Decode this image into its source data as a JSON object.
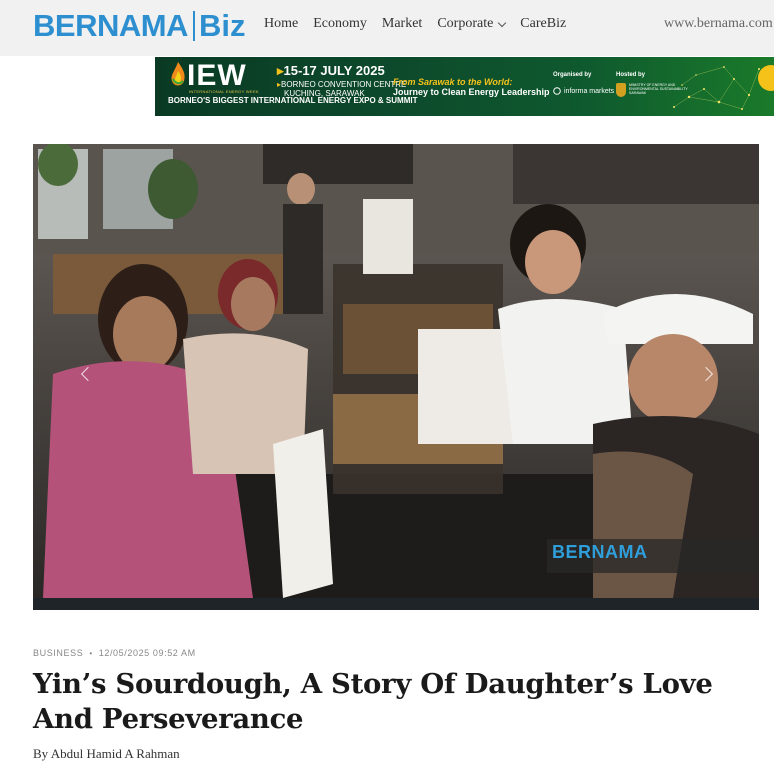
{
  "header": {
    "logo_main": "BERNAMA",
    "logo_sub": "Biz",
    "nav": [
      {
        "label": "Home"
      },
      {
        "label": "Economy"
      },
      {
        "label": "Market"
      },
      {
        "label": "Corporate",
        "has_dropdown": true
      },
      {
        "label": "CareBiz"
      }
    ],
    "site_link": "www.bernama.com"
  },
  "banner": {
    "event_abbr": "IEW",
    "event_full": "INTERNATIONAL ENERGY WEEK",
    "dates": "15-17 JULY 2025",
    "venue_line1": "BORNEO CONVENTION CENTRE",
    "venue_line2": "KUCHING, SARAWAK",
    "tagline": "BORNEO'S BIGGEST INTERNATIONAL ENERGY EXPO & SUMMIT",
    "slogan_line1": "From Sarawak to the World:",
    "slogan_line2": "Journey to Clean Energy Leadership",
    "organised_by_label": "Organised by",
    "organiser": "informa markets",
    "hosted_by_label": "Hosted by",
    "host": "MINISTRY OF ENERGY AND ENVIRONMENTAL SUSTAINABILITY SARAWAK"
  },
  "photo": {
    "watermark": "BERNAMA"
  },
  "article": {
    "category": "BUSINESS",
    "datetime": "12/05/2025 09:52 AM",
    "title": "Yin’s Sourdough, A Story Of Daughter’s Love And Perseverance",
    "byline": "By Abdul Hamid A Rahman"
  },
  "colors": {
    "brand_blue": "#2d8fcf",
    "header_bg": "#f1f1f1",
    "banner_green": "#0d4a2c",
    "banner_accent": "#f5c21a"
  }
}
